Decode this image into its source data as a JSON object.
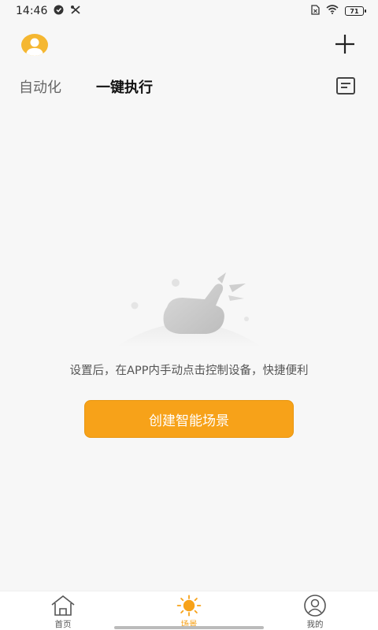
{
  "status_bar": {
    "time": "14:46",
    "battery_level": "71",
    "icons": [
      "notification-icon",
      "tools-icon",
      "sim-icon",
      "wifi-icon",
      "battery-icon"
    ]
  },
  "header": {
    "avatar_icon": "avatar-icon",
    "add_icon": "plus-icon"
  },
  "tabs": [
    {
      "label": "自动化",
      "active": false
    },
    {
      "label": "一键执行",
      "active": true
    }
  ],
  "log_icon": "log-icon",
  "empty_state": {
    "illustration_icon": "hand-tap-illustration",
    "message": "设置后，在APP内手动点击控制设备，快捷便利",
    "button_label": "创建智能场景"
  },
  "bottom_nav": {
    "items": [
      {
        "label": "首页",
        "icon": "home-icon",
        "active": false
      },
      {
        "label": "场景",
        "icon": "sun-icon",
        "active": true
      },
      {
        "label": "我的",
        "icon": "user-icon",
        "active": false
      }
    ]
  },
  "colors": {
    "accent": "#f7a219",
    "background": "#f7f7f7",
    "avatar": "#f5b731"
  }
}
